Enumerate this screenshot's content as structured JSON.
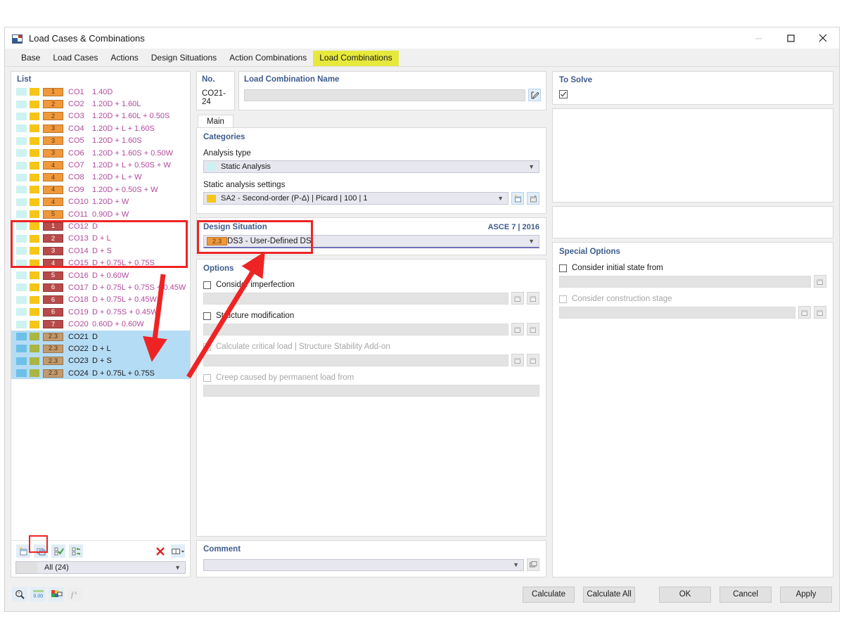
{
  "window": {
    "title": "Load Cases & Combinations",
    "icon": "app-icon",
    "minimize": "—",
    "maximize": "□",
    "close": "✕"
  },
  "tabs": [
    {
      "label": "Base",
      "active": false
    },
    {
      "label": "Load Cases",
      "active": false
    },
    {
      "label": "Actions",
      "active": false
    },
    {
      "label": "Design Situations",
      "active": false
    },
    {
      "label": "Action Combinations",
      "active": false
    },
    {
      "label": "Load Combinations",
      "active": true
    }
  ],
  "list": {
    "title": "List",
    "filter_label": "All (24)",
    "toolbar": [
      {
        "name": "new-combination-icon"
      },
      {
        "name": "copy-combination-icon"
      },
      {
        "name": "select-all-icon"
      },
      {
        "name": "invert-selection-icon"
      },
      {
        "name": "delete-icon"
      },
      {
        "name": "columns-icon"
      }
    ],
    "rows": [
      {
        "no": "CO1",
        "formula": "1.40D",
        "badge": "1",
        "group": "orange"
      },
      {
        "no": "CO2",
        "formula": "1.20D + 1.60L",
        "badge": "2",
        "group": "orange"
      },
      {
        "no": "CO3",
        "formula": "1.20D + 1.60L + 0.50S",
        "badge": "2",
        "group": "orange"
      },
      {
        "no": "CO4",
        "formula": "1.20D + L + 1.60S",
        "badge": "3",
        "group": "orange"
      },
      {
        "no": "CO5",
        "formula": "1.20D + 1.60S",
        "badge": "3",
        "group": "orange"
      },
      {
        "no": "CO6",
        "formula": "1.20D + 1.60S + 0.50W",
        "badge": "3",
        "group": "orange"
      },
      {
        "no": "CO7",
        "formula": "1.20D + L + 0.50S + W",
        "badge": "4",
        "group": "orange"
      },
      {
        "no": "CO8",
        "formula": "1.20D + L + W",
        "badge": "4",
        "group": "orange"
      },
      {
        "no": "CO9",
        "formula": "1.20D + 0.50S + W",
        "badge": "4",
        "group": "orange"
      },
      {
        "no": "CO10",
        "formula": "1.20D + W",
        "badge": "4",
        "group": "orange"
      },
      {
        "no": "CO11",
        "formula": "0.90D + W",
        "badge": "5",
        "group": "orange"
      },
      {
        "no": "CO12",
        "formula": "D",
        "badge": "1",
        "group": "red"
      },
      {
        "no": "CO13",
        "formula": "D + L",
        "badge": "2",
        "group": "red"
      },
      {
        "no": "CO14",
        "formula": "D + S",
        "badge": "3",
        "group": "red"
      },
      {
        "no": "CO15",
        "formula": "D + 0.75L + 0.75S",
        "badge": "4",
        "group": "red"
      },
      {
        "no": "CO16",
        "formula": "D + 0.60W",
        "badge": "5",
        "group": "red"
      },
      {
        "no": "CO17",
        "formula": "D + 0.75L + 0.75S + 0.45W",
        "badge": "6",
        "group": "red"
      },
      {
        "no": "CO18",
        "formula": "D + 0.75L + 0.45W",
        "badge": "6",
        "group": "red"
      },
      {
        "no": "CO19",
        "formula": "D + 0.75S + 0.45W",
        "badge": "6",
        "group": "red"
      },
      {
        "no": "CO20",
        "formula": "0.60D + 0.60W",
        "badge": "7",
        "group": "red"
      },
      {
        "no": "CO21",
        "formula": "D",
        "badge": "2.3",
        "group": "tan",
        "selected": true
      },
      {
        "no": "CO22",
        "formula": "D + L",
        "badge": "2.3",
        "group": "tan",
        "selected": true
      },
      {
        "no": "CO23",
        "formula": "D + S",
        "badge": "2.3",
        "group": "tan",
        "selected": true
      },
      {
        "no": "CO24",
        "formula": "D + 0.75L + 0.75S",
        "badge": "2.3",
        "group": "tan",
        "selected": true
      }
    ]
  },
  "detail": {
    "no_label": "No.",
    "no_value": "CO21-24",
    "name_label": "Load Combination Name",
    "name_value": "",
    "name_edit_icon": "edit-name-icon",
    "inner_tab": "Main",
    "categories": {
      "title": "Categories",
      "analysis_type_label": "Analysis type",
      "analysis_type_value": "Static Analysis",
      "static_settings_label": "Static analysis settings",
      "static_settings_value": "SA2 - Second-order (P-Δ) | Picard | 100 | 1",
      "new_icon": "new-settings-icon",
      "edit_icon": "edit-settings-icon"
    },
    "design_situation": {
      "title": "Design Situation",
      "standard": "ASCE 7 | 2016",
      "badge": "2.3",
      "value": "DS3 - User-Defined DS"
    },
    "options": {
      "title": "Options",
      "items": [
        {
          "label": "Consider imperfection",
          "checked": false,
          "enabled": true,
          "buttons": 2
        },
        {
          "label": "Structure modification",
          "checked": false,
          "enabled": true,
          "buttons": 2
        },
        {
          "label": "Calculate critical load | Structure Stability Add-on",
          "checked": false,
          "enabled": false,
          "buttons": 2
        },
        {
          "label": "Creep caused by permanent load from",
          "checked": false,
          "enabled": false,
          "buttons": 0
        }
      ]
    },
    "comment": {
      "title": "Comment",
      "value": "",
      "icon": "comment-library-icon"
    }
  },
  "to_solve": {
    "title": "To Solve",
    "checked": true
  },
  "special_options": {
    "title": "Special Options",
    "items": [
      {
        "label": "Consider initial state from",
        "checked": false,
        "enabled": true,
        "buttons": 1
      },
      {
        "label": "Consider construction stage",
        "checked": false,
        "enabled": false,
        "buttons": 2
      }
    ]
  },
  "status_icons": [
    {
      "name": "find-icon",
      "enabled": true
    },
    {
      "name": "decimals-icon",
      "enabled": true
    },
    {
      "name": "units-icon",
      "enabled": true
    },
    {
      "name": "formula-icon",
      "enabled": false
    }
  ],
  "footer_buttons": [
    {
      "label": "Calculate"
    },
    {
      "label": "Calculate All"
    },
    {
      "label": "OK"
    },
    {
      "label": "Cancel"
    },
    {
      "label": "Apply"
    }
  ],
  "colors": {
    "tab_highlight": "#e6e83c",
    "orange_badge": "#f0983a",
    "red_badge": "#b94a4a",
    "tan_badge": "#c49a6c",
    "selection": "#b5dcf5",
    "annotation": "#ee2424",
    "header_blue": "#3e5c8c",
    "formula_magenta": "#b2499b"
  }
}
